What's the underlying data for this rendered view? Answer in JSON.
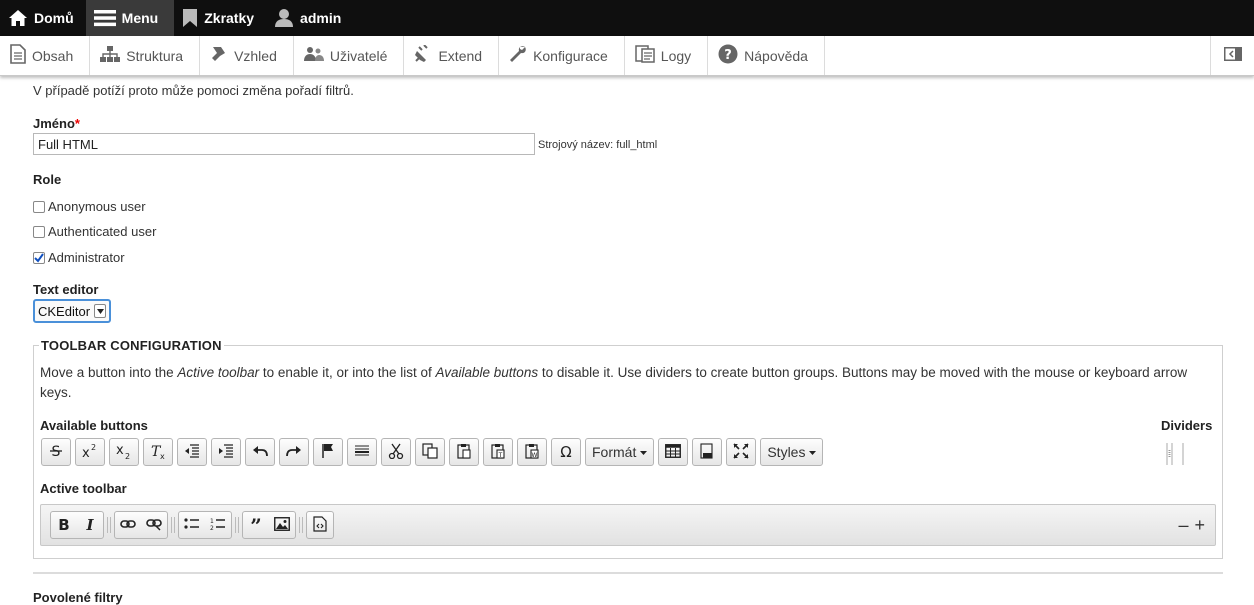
{
  "topbar": {
    "home": "Domů",
    "menu": "Menu",
    "shortcuts": "Zkratky",
    "user": "admin"
  },
  "tray": {
    "items": [
      "Obsah",
      "Struktura",
      "Vzhled",
      "Uživatelé",
      "Extend",
      "Konfigurace",
      "Logy",
      "Nápověda"
    ]
  },
  "form": {
    "note": "V případě potíží proto může pomoci změna pořadí filtrů.",
    "name_label": "Jméno",
    "required_mark": "*",
    "name_value": "Full HTML",
    "machine_name": "Strojový název: full_html",
    "role_label": "Role",
    "roles": [
      {
        "label": "Anonymous user",
        "checked": false
      },
      {
        "label": "Authenticated user",
        "checked": false
      },
      {
        "label": "Administrator",
        "checked": true
      }
    ],
    "editor_label": "Text editor",
    "editor_value": "CKEditor"
  },
  "toolbar_config": {
    "legend": "TOOLBAR CONFIGURATION",
    "desc_1": "Move a button into the ",
    "desc_active": "Active toolbar",
    "desc_2": " to enable it, or into the list of ",
    "desc_available": "Available buttons",
    "desc_3": " to disable it. Use dividers to create button groups. Buttons may be moved with the mouse or keyboard arrow keys.",
    "available_label": "Available buttons",
    "dividers_label": "Dividers",
    "format_label": "Formát",
    "styles_label": "Styles",
    "active_label": "Active toolbar",
    "minus": "–",
    "plus": "+"
  },
  "filters_label": "Povolené filtry",
  "colors": {
    "topbar_bg": "#0f0f0f",
    "active_menu_bg": "#3a3a3a",
    "required": "#e00000",
    "focus": "#4a90d9"
  }
}
